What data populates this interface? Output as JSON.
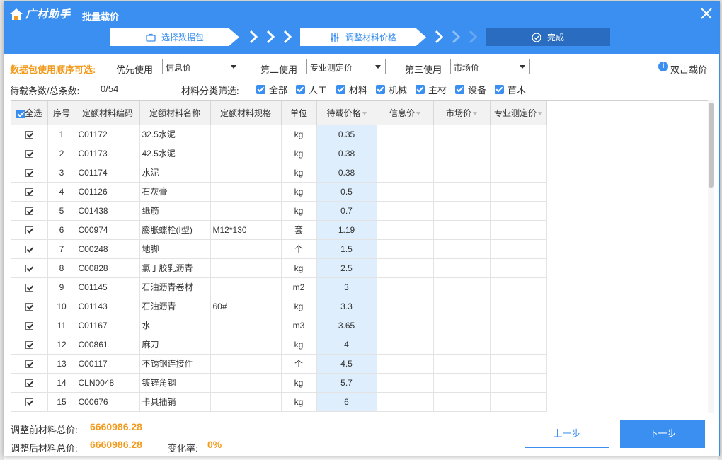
{
  "app": {
    "logo_text": "广材助手",
    "dialog_title": "批量载价"
  },
  "steps": [
    {
      "label": "选择数据包",
      "icon": "briefcase-icon",
      "state": "done"
    },
    {
      "label": "调整材料价格",
      "icon": "sliders-icon",
      "state": "current"
    },
    {
      "label": "完成",
      "icon": "check-circle-icon",
      "state": "pending"
    }
  ],
  "priority": {
    "label": "数据包使用顺序可选:",
    "first_label": "优先使用",
    "first_value": "信息价",
    "second_label": "第二使用",
    "second_value": "专业测定价",
    "third_label": "第三使用",
    "third_value": "市场价",
    "double_click_hint": "双击载价"
  },
  "counts": {
    "label": "待载条数/总条数:",
    "value": "0/54"
  },
  "category_filter": {
    "label": "材料分类筛选:",
    "options": [
      "全部",
      "人工",
      "材料",
      "机械",
      "主材",
      "设备",
      "苗木"
    ]
  },
  "table": {
    "headers": {
      "select_all": "全选",
      "index": "序号",
      "code": "定额材料编码",
      "name": "定额材料名称",
      "spec": "定额材料规格",
      "unit": "单位",
      "price": "待载价格",
      "info_price": "信息价",
      "market_price": "市场价",
      "measured_price": "专业测定价"
    },
    "rows": [
      {
        "no": "1",
        "code": "C01172",
        "name": "32.5水泥",
        "spec": "",
        "unit": "kg",
        "price": "0.35"
      },
      {
        "no": "2",
        "code": "C01173",
        "name": "42.5水泥",
        "spec": "",
        "unit": "kg",
        "price": "0.38"
      },
      {
        "no": "3",
        "code": "C01174",
        "name": "水泥",
        "spec": "",
        "unit": "kg",
        "price": "0.38"
      },
      {
        "no": "4",
        "code": "C01126",
        "name": "石灰膏",
        "spec": "",
        "unit": "kg",
        "price": "0.5"
      },
      {
        "no": "5",
        "code": "C01438",
        "name": "纸筋",
        "spec": "",
        "unit": "kg",
        "price": "0.7"
      },
      {
        "no": "6",
        "code": "C00974",
        "name": "膨胀螺栓(I型)",
        "spec": "M12*130",
        "unit": "套",
        "price": "1.19"
      },
      {
        "no": "7",
        "code": "C00248",
        "name": "地脚",
        "spec": "",
        "unit": "个",
        "price": "1.5"
      },
      {
        "no": "8",
        "code": "C00828",
        "name": "氯丁胶乳沥青",
        "spec": "",
        "unit": "kg",
        "price": "2.5"
      },
      {
        "no": "9",
        "code": "C01145",
        "name": "石油沥青卷材",
        "spec": "",
        "unit": "m2",
        "price": "3"
      },
      {
        "no": "10",
        "code": "C01143",
        "name": "石油沥青",
        "spec": "60#",
        "unit": "kg",
        "price": "3.3"
      },
      {
        "no": "11",
        "code": "C01167",
        "name": "水",
        "spec": "",
        "unit": "m3",
        "price": "3.65"
      },
      {
        "no": "12",
        "code": "C00861",
        "name": "麻刀",
        "spec": "",
        "unit": "kg",
        "price": "4"
      },
      {
        "no": "13",
        "code": "C00117",
        "name": "不锈钢连接件",
        "spec": "",
        "unit": "个",
        "price": "4.5"
      },
      {
        "no": "14",
        "code": "CLN0048",
        "name": "镀锌角钢",
        "spec": "",
        "unit": "kg",
        "price": "5.7"
      },
      {
        "no": "15",
        "code": "C00676",
        "name": "卡具插销",
        "spec": "",
        "unit": "kg",
        "price": "6"
      }
    ]
  },
  "summary": {
    "before_label": "调整前材料总价:",
    "before_value": "6660986.28",
    "after_label": "调整后材料总价:",
    "after_value": "6660986.28",
    "change_label": "变化率:",
    "change_value": "0%"
  },
  "buttons": {
    "prev": "上一步",
    "next": "下一步"
  },
  "colors": {
    "primary": "#3a8ff0",
    "accent_orange": "#f29a1b",
    "price_column_bg": "#deeefc"
  }
}
